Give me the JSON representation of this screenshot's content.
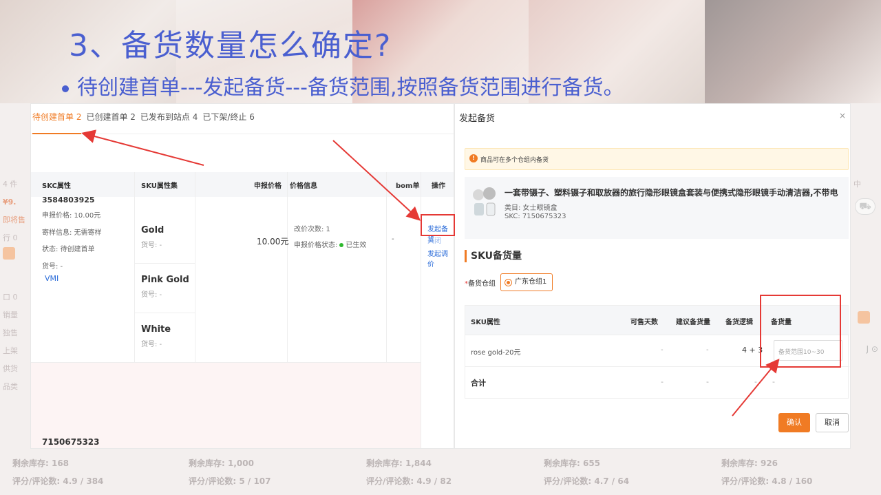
{
  "slide": {
    "title": "3、备货数量怎么确定?",
    "subtitle": "待创建首单---发起备货---备货范围,按照备货范围进行备货。"
  },
  "tabs": [
    {
      "label": "待创建首单 2",
      "active": true
    },
    {
      "label": "已创建首单 2",
      "active": false
    },
    {
      "label": "已发布到站点 4",
      "active": false
    },
    {
      "label": "已下架/终止 6",
      "active": false
    }
  ],
  "table": {
    "headers": [
      "SKC属性",
      "SKU属性集",
      "申报价格",
      "价格信息",
      "bom单",
      "操作"
    ],
    "row": {
      "skc_partial": "3584803925",
      "declared_price_line": "申报价格: 10.00元",
      "sample_line": "寄样信息: 无需寄样",
      "status_line": "状态: 待创建首单",
      "goods_no": "货号: -",
      "vmi": "VMI",
      "skus": [
        {
          "name": "Gold",
          "sub": "货号: -"
        },
        {
          "name": "Pink Gold",
          "sub": "货号: -"
        },
        {
          "name": "White",
          "sub": "货号: -"
        }
      ],
      "price": "10.00元",
      "price_changes": "改价次数: 1",
      "price_status_label": "申报价格状态:",
      "price_status": "已生效",
      "bom": "-",
      "actions": [
        "发起备货",
        "关闭",
        "发起调价"
      ]
    },
    "next_skc": "7150675323"
  },
  "dialog": {
    "title": "发起备货",
    "close": "×",
    "notice": "商品可在多个仓组内备货",
    "product_name": "一套带镊子、塑料镊子和取放器的旅行隐形眼镜盒套装与便携式隐形眼镜手动清洁器,不带电",
    "category": "类目: 女士眼镜盒",
    "skc": "SKC: 7150675323",
    "section": "SKU备货量",
    "warehouse_label": "备货仓组",
    "warehouse": "广东仓组1",
    "sku_table": {
      "headers": [
        "SKU属性",
        "可售天数",
        "建议备货量",
        "备货逻辑",
        "备货量"
      ],
      "row": [
        "rose gold-20元",
        "-",
        "-",
        "4 + 3"
      ],
      "qty_placeholder": "备货范围10~30",
      "total_label": "合计",
      "total": [
        "-",
        "-",
        "-",
        "-"
      ]
    },
    "confirm": "确认",
    "cancel": "取消"
  },
  "background": {
    "left_fragments": [
      "4 件",
      "¥9.",
      "即将售",
      "行 0",
      "口 0",
      "销量",
      "独售",
      "上架",
      "供货",
      "品类"
    ],
    "right_fragments": [
      "中",
      "J ⊙"
    ],
    "footer": [
      {
        "stock": "剩余库存: 168",
        "rating": "评分/评论数: 4.9 / 384"
      },
      {
        "stock": "剩余库存: 1,000",
        "rating": "评分/评论数: 5 / 107"
      },
      {
        "stock": "剩余库存: 1,844",
        "rating": "评分/评论数: 4.9 / 82"
      },
      {
        "stock": "剩余库存: 655",
        "rating": "评分/评论数: 4.7 / 64"
      },
      {
        "stock": "剩余库存: 926",
        "rating": "评分/评论数: 4.8 / 160"
      }
    ]
  },
  "colors": {
    "title": "#4a5fd0",
    "accent": "#f07b24",
    "annotation": "#e53935"
  }
}
